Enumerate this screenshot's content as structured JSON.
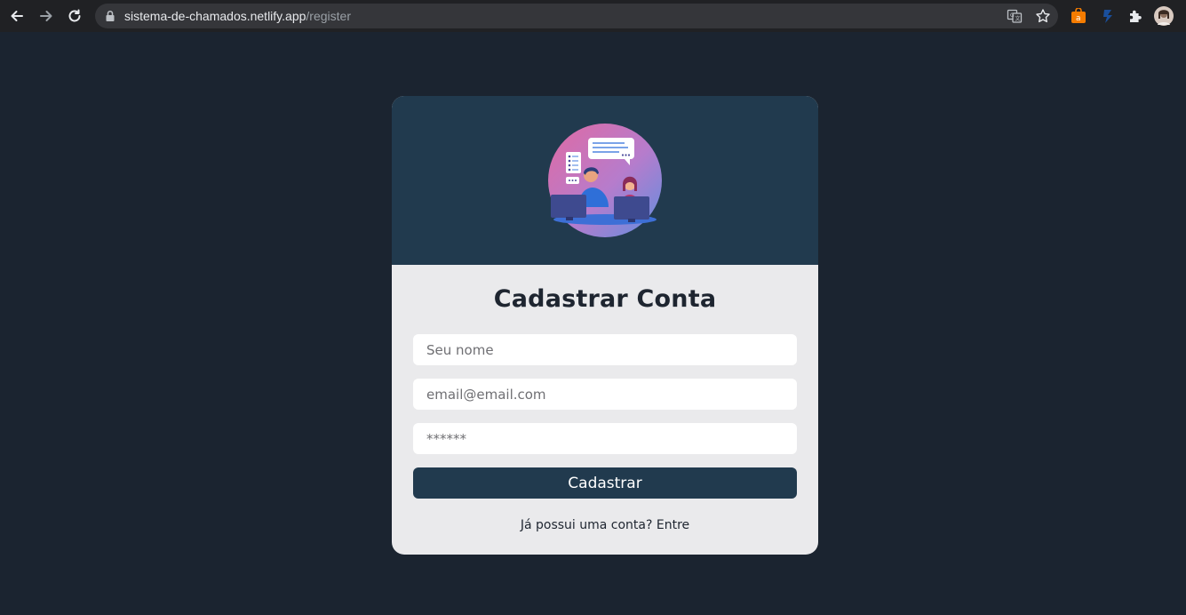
{
  "browser": {
    "url_host": "sistema-de-chamados.netlify.app",
    "url_path": "/register"
  },
  "icons": {
    "back": "back-arrow-icon",
    "forward": "forward-arrow-icon",
    "reload": "reload-icon",
    "lock": "lock-icon",
    "translate": "translate-icon",
    "bookmark": "star-icon",
    "extension_1": "shopping-bag-icon",
    "extension_2": "extension-icon",
    "extensions": "puzzle-icon",
    "profile": "avatar"
  },
  "colors": {
    "page_bg": "#1b2430",
    "card_header_bg": "#213a4e",
    "card_body_bg": "#eaeaec",
    "button_bg": "#213a4e"
  },
  "form": {
    "title": "Cadastrar Conta",
    "name_placeholder": "Seu nome",
    "email_placeholder": "email@email.com",
    "password_placeholder": "******",
    "submit_label": "Cadastrar",
    "login_link": "Já possui uma conta? Entre"
  }
}
